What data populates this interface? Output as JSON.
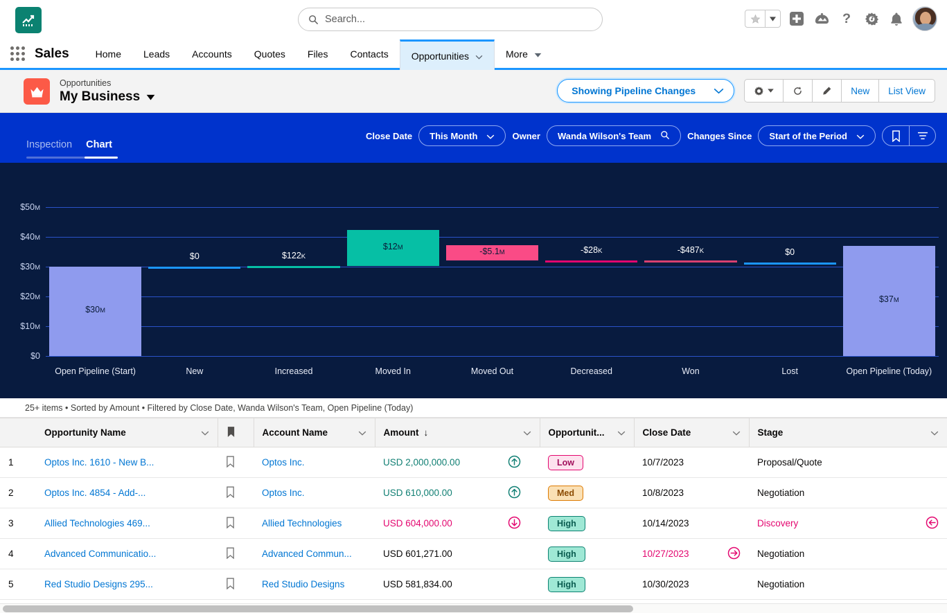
{
  "global_header": {
    "app_logo_icon": "trending-chart-icon",
    "search": {
      "placeholder": "Search...",
      "value": "",
      "icon": "search-icon"
    },
    "favorites": {
      "star_icon": "star-icon",
      "caret_icon": "chevron-down-icon"
    },
    "actions": [
      {
        "name": "global-create-icon",
        "glyph": "+"
      },
      {
        "name": "einstein-icon",
        "glyph": "einstein"
      },
      {
        "name": "help-icon",
        "glyph": "?"
      },
      {
        "name": "setup-gear-icon",
        "glyph": "gear"
      },
      {
        "name": "notifications-bell-icon",
        "glyph": "bell"
      }
    ],
    "avatar_name": "user-avatar"
  },
  "app_nav": {
    "waffle_icon": "app-launcher-icon",
    "app_name": "Sales",
    "items": [
      {
        "label": "Home",
        "active": false,
        "caret": false
      },
      {
        "label": "Leads",
        "active": false,
        "caret": false
      },
      {
        "label": "Accounts",
        "active": false,
        "caret": false
      },
      {
        "label": "Quotes",
        "active": false,
        "caret": false
      },
      {
        "label": "Files",
        "active": false,
        "caret": false
      },
      {
        "label": "Contacts",
        "active": false,
        "caret": false
      },
      {
        "label": "Opportunities",
        "active": true,
        "caret": true
      },
      {
        "label": "More",
        "active": false,
        "caret": true
      }
    ]
  },
  "object_header": {
    "icon": "crown-icon",
    "object_label": "Opportunities",
    "list_view_name": "My Business",
    "list_view_caret": "caret-down-icon",
    "showing_pill": {
      "label": "Showing Pipeline Changes",
      "caret": "chevron-down-icon"
    },
    "buttons": [
      {
        "name": "list-view-controls-button",
        "label": "",
        "icon": "gear-icon",
        "caret": true
      },
      {
        "name": "refresh-button",
        "label": "",
        "icon": "refresh-icon",
        "caret": false
      },
      {
        "name": "edit-button",
        "label": "",
        "icon": "pencil-icon",
        "caret": false
      },
      {
        "name": "new-button",
        "label": "New",
        "icon": "",
        "caret": false
      },
      {
        "name": "list-view-button",
        "label": "List View",
        "icon": "",
        "caret": false
      }
    ]
  },
  "filter_bar": {
    "tabs": [
      {
        "label": "Inspection",
        "active": false
      },
      {
        "label": "Chart",
        "active": true
      }
    ],
    "close_date_label": "Close Date",
    "close_date_value": "This Month",
    "owner_label": "Owner",
    "owner_value": "Wanda Wilson's Team",
    "owner_icon": "search-icon",
    "changes_since_label": "Changes Since",
    "changes_since_value": "Start of the Period",
    "bookmark_icon": "bookmark-icon",
    "menu_icon": "filter-list-icon"
  },
  "chart_data": {
    "type": "bar",
    "title": "",
    "subtitle": "",
    "xlabel": "",
    "ylabel": "",
    "grid": true,
    "legend": "none",
    "ylim": [
      0,
      55000000
    ],
    "ytick_values": [
      0,
      10000000,
      20000000,
      30000000,
      40000000,
      50000000
    ],
    "ytick_labels": [
      "$0",
      "$10M",
      "$20M",
      "$30M",
      "$40M",
      "$50M"
    ],
    "categories": [
      "Open Pipeline (Start)",
      "New",
      "Increased",
      "Moved In",
      "Moved Out",
      "Decreased",
      "Won",
      "Lost",
      "Open Pipeline (Today)"
    ],
    "values": [
      30000000,
      0,
      122000,
      12000000,
      -5100000,
      -28000,
      -487000,
      0,
      37000000
    ],
    "value_labels": [
      "$30M",
      "$0",
      "$122K",
      "$12M",
      "-$5.1M",
      "-$28K",
      "-$487K",
      "$0",
      "$37M"
    ],
    "bar_colors": [
      "#8f9bee",
      "#1b96ff",
      "#06bfa5",
      "#06bfa5",
      "#fa4b86",
      "#e3066f",
      "#d94070",
      "#1b96ff",
      "#8f9bee"
    ],
    "waterfall_bases": [
      0,
      30000000,
      30000000,
      30122000,
      37022000,
      31950000,
      31922000,
      31435000,
      0
    ],
    "label_inside": [
      true,
      false,
      false,
      true,
      true,
      false,
      false,
      false,
      true
    ]
  },
  "list_summary": "25+ items • Sorted by Amount • Filtered by Close Date, Wanda Wilson's Team, Open Pipeline (Today)",
  "table": {
    "columns": [
      {
        "key": "rownum",
        "label": "",
        "caret": false,
        "sorted": false
      },
      {
        "key": "opportunity_name",
        "label": "Opportunity Name",
        "caret": true,
        "sorted": false
      },
      {
        "key": "bookmark",
        "label": "",
        "caret": false,
        "sorted": false,
        "icon": "bookmark-filled-icon"
      },
      {
        "key": "account_name",
        "label": "Account Name",
        "caret": true,
        "sorted": false
      },
      {
        "key": "amount",
        "label": "Amount",
        "caret": true,
        "sorted": true,
        "sort_glyph": "↓"
      },
      {
        "key": "trend",
        "label": "",
        "caret": true,
        "sorted": false
      },
      {
        "key": "opportunity_score",
        "label": "Opportunit...",
        "caret": true,
        "sorted": false
      },
      {
        "key": "close_date",
        "label": "Close Date",
        "caret": true,
        "sorted": false
      },
      {
        "key": "stage",
        "label": "Stage",
        "caret": true,
        "sorted": false
      }
    ],
    "rows": [
      {
        "rownum": "1",
        "opportunity_name": "Optos Inc. 1610 - New B...",
        "account_name": "Optos Inc.",
        "amount": "USD 2,000,000.00",
        "amount_state": "up",
        "trend_icon": "arrow-up-circle-icon",
        "score": "Low",
        "score_level": "low",
        "close_date": "10/7/2023",
        "close_date_state": "normal",
        "date_icon": "",
        "stage": "Proposal/Quote",
        "stage_state": "normal",
        "stage_icon": ""
      },
      {
        "rownum": "2",
        "opportunity_name": "Optos Inc. 4854 - Add-...",
        "account_name": "Optos Inc.",
        "amount": "USD 610,000.00",
        "amount_state": "up",
        "trend_icon": "arrow-up-circle-icon",
        "score": "Med",
        "score_level": "med",
        "close_date": "10/8/2023",
        "close_date_state": "normal",
        "date_icon": "",
        "stage": "Negotiation",
        "stage_state": "normal",
        "stage_icon": ""
      },
      {
        "rownum": "3",
        "opportunity_name": "Allied Technologies 469...",
        "account_name": "Allied Technologies",
        "amount": "USD 604,000.00",
        "amount_state": "down",
        "trend_icon": "arrow-down-circle-icon",
        "score": "High",
        "score_level": "high",
        "close_date": "10/14/2023",
        "close_date_state": "normal",
        "date_icon": "",
        "stage": "Discovery",
        "stage_state": "alert",
        "stage_icon": "arrow-left-circle-icon"
      },
      {
        "rownum": "4",
        "opportunity_name": "Advanced Communicatio...",
        "account_name": "Advanced Commun...",
        "amount": "USD 601,271.00",
        "amount_state": "normal",
        "trend_icon": "",
        "score": "High",
        "score_level": "high",
        "close_date": "10/27/2023",
        "close_date_state": "alert",
        "date_icon": "arrow-right-circle-icon",
        "stage": "Negotiation",
        "stage_state": "normal",
        "stage_icon": ""
      },
      {
        "rownum": "5",
        "opportunity_name": "Red Studio Designs 295...",
        "account_name": "Red Studio Designs",
        "amount": "USD 581,834.00",
        "amount_state": "normal",
        "trend_icon": "",
        "score": "High",
        "score_level": "high",
        "close_date": "10/30/2023",
        "close_date_state": "normal",
        "date_icon": "",
        "stage": "Negotiation",
        "stage_state": "normal",
        "stage_icon": ""
      }
    ]
  },
  "colors": {
    "brand_blue": "#0176d3",
    "nav_accent": "#1b96ff",
    "filter_bar_bg": "#0033cc",
    "chart_bg": "#081b3f",
    "chart_grid": "#2a52c9",
    "bar_neutral": "#8f9bee",
    "bar_positive": "#06bfa5",
    "bar_negative": "#fa4b86",
    "object_icon_bg": "#fc5a47",
    "app_icon_bg": "#0b8271"
  }
}
